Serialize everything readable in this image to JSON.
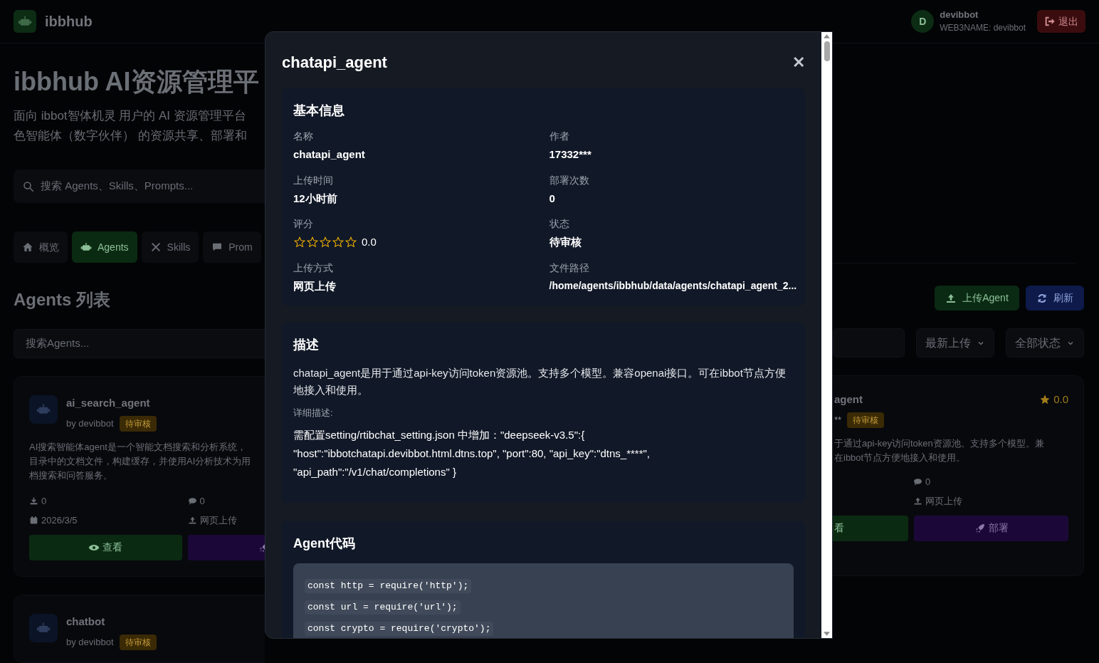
{
  "header": {
    "brand": "ibbhub",
    "avatar_letter": "D",
    "user_name": "devibbot",
    "web3name": "WEB3NAME: devibbot",
    "logout": "退出"
  },
  "hero": {
    "title": "ibbhub AI资源管理平",
    "subtitle_lines": [
      "面向 ibbot智体机灵 用户的 AI 资源管理平台",
      "色智能体（数字伙伴） 的资源共享、部署和"
    ]
  },
  "global_search": {
    "placeholder": "搜索 Agents、Skills、Prompts..."
  },
  "tabs": [
    {
      "label": "概览",
      "kind": "home",
      "selected": false
    },
    {
      "label": "Agents",
      "kind": "robot",
      "selected": true
    },
    {
      "label": "Skills",
      "kind": "tools",
      "selected": false
    },
    {
      "label": "Prom",
      "kind": "chat",
      "selected": false
    }
  ],
  "section_title": "Agents 列表",
  "actions": [
    {
      "label": "上传Agent",
      "kind": "upload"
    },
    {
      "label": "刷新",
      "kind": "refresh"
    }
  ],
  "agent_search": {
    "placeholder": "搜索Agents..."
  },
  "filters": [
    {
      "value": "最新上传"
    },
    {
      "value": "全部状态"
    }
  ],
  "left_cards": [
    {
      "name": "ai_search_agent",
      "author": "by devibbot",
      "status": "待审核",
      "description_lines": [
        "AI搜索智能体agent是一个智能文档搜索和分析系统，",
        "目录中的文档文件，构建缓存，并使用AI分析技术为用",
        "档搜索和问答服务。"
      ],
      "downloads": "0",
      "comments": "0",
      "date": "2026/3/5",
      "upload_method": "网页上传",
      "view": "查看"
    },
    {
      "name": "chatbot",
      "author": "by devibbot",
      "status": "待审核"
    }
  ],
  "right_card": {
    "name": "agent",
    "author": "**",
    "status": "待审核",
    "rating": "0.0",
    "description_lines": [
      "于通过api-key访问token资源池。支持多个模型。兼",
      "在ibbot节点方便地接入和使用。"
    ],
    "comments": "0",
    "upload_method": "网页上传",
    "view": "看",
    "deploy": "部署"
  },
  "modal": {
    "title": "chatapi_agent",
    "close": "✕",
    "basic": {
      "heading": "基本信息",
      "fields": [
        {
          "label": "名称",
          "value": "chatapi_agent",
          "kind": "text"
        },
        {
          "label": "作者",
          "value": "17332***",
          "kind": "text"
        },
        {
          "label": "上传时间",
          "value": "12小时前",
          "kind": "text"
        },
        {
          "label": "部署次数",
          "value": "0",
          "kind": "text"
        },
        {
          "label": "评分",
          "value": "0.0",
          "kind": "rating",
          "stars": 0
        },
        {
          "label": "状态",
          "value": "待审核",
          "kind": "text"
        },
        {
          "label": "上传方式",
          "value": "网页上传",
          "kind": "text"
        },
        {
          "label": "文件路径",
          "value": "/home/agents/ibbhub/data/agents/chatapi_agent_2...",
          "kind": "path"
        }
      ]
    },
    "description": {
      "heading": "描述",
      "summary": "chatapi_agent是用于通过api-key访问token资源池。支持多个模型。兼容openai接口。可在ibbot节点方便地接入和使用。",
      "detail_label": "详细描述:",
      "detail": "需配置setting/rtibchat_setting.json 中增加：\"deepseek-v3.5\":{ \"host\":\"ibbotchatapi.devibbot.html.dtns.top\", \"port\":80, \"api_key\":\"dtns_****\", \"api_path\":\"/v1/chat/completions\" }"
    },
    "code": {
      "heading": "Agent代码",
      "lines": [
        "const http = require('http');",
        "const url = require('url');",
        "const crypto = require('crypto');"
      ]
    }
  }
}
